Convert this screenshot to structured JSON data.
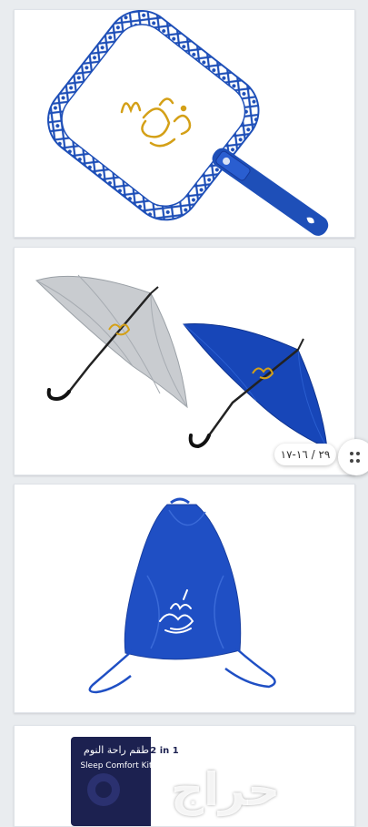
{
  "listing": {
    "gallery_counter": "٢٩ / ١٦-١٧",
    "watermark": "حراج",
    "images": [
      {
        "product": "hand-fan",
        "accent_color": "#1e4fb8",
        "logo_color": "#d4a017"
      },
      {
        "product": "umbrellas",
        "silver_color": "#c9ccd0",
        "blue_color": "#1746b8"
      },
      {
        "product": "drawstring-bag",
        "bag_color": "#1f4fc4"
      },
      {
        "product": "sleep-comfort-kit",
        "box_title_ar": "طقم راحة النوم",
        "box_title_en": "Sleep Comfort Kit",
        "badge": "2 in 1"
      }
    ]
  }
}
